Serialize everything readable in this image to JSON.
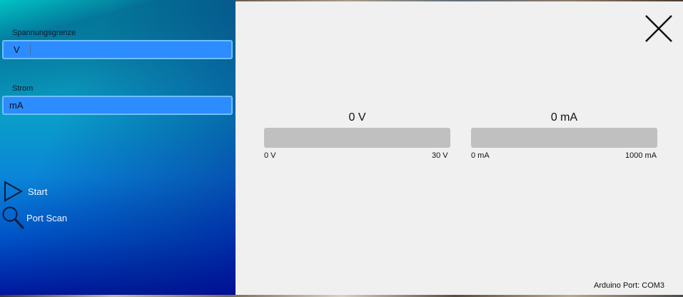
{
  "sidebar": {
    "voltage_limit": {
      "label": "Spannungsgrenze",
      "value": "V"
    },
    "current": {
      "label": "Strom",
      "value": "mA"
    },
    "menu": {
      "start_label": "Start",
      "portscan_label": "Port Scan"
    }
  },
  "gauges": {
    "voltage": {
      "value_text": "0 V",
      "min_label": "0 V",
      "max_label": "30 V",
      "fill_fraction": 0
    },
    "current": {
      "value_text": "0 mA",
      "min_label": "0 mA",
      "max_label": "1000 mA",
      "fill_fraction": 0
    }
  },
  "status": {
    "port_text": "Arduino Port: COM3"
  },
  "colors": {
    "input_background": "#2d8cff",
    "gauge_track": "#c0c0c0",
    "main_background": "#f0f0f0"
  }
}
